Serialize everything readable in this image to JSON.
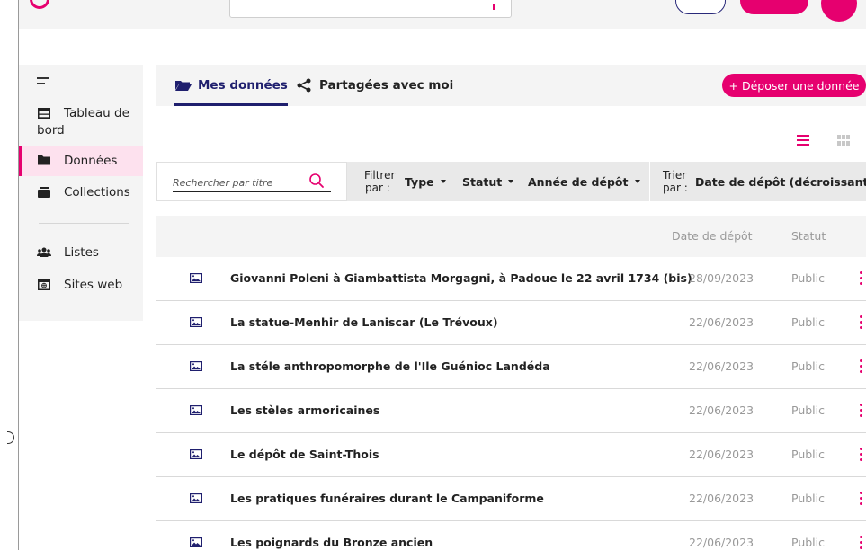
{
  "sidebar": {
    "items": [
      {
        "key": "dashboard",
        "label": "Tableau de bord",
        "icon": "table-icon"
      },
      {
        "key": "data",
        "label": "Données",
        "icon": "folder-icon",
        "active": true
      },
      {
        "key": "collections",
        "label": "Collections",
        "icon": "collections-icon"
      },
      {
        "key": "lists",
        "label": "Listes",
        "icon": "users-icon"
      },
      {
        "key": "websites",
        "label": "Sites web",
        "icon": "website-icon"
      }
    ]
  },
  "tabs": [
    {
      "label": "Mes données",
      "icon": "folder-open-icon",
      "active": true
    },
    {
      "label": "Partagées avec moi",
      "icon": "share-icon"
    }
  ],
  "deposit_button": "+ Déposer une donnée",
  "search": {
    "placeholder": "Rechercher par titre"
  },
  "filters": {
    "label": "Filtrer par :",
    "label_line1": "Filtrer",
    "label_line2": "par :",
    "type": "Type",
    "status": "Statut",
    "year": "Année de dépôt"
  },
  "sort": {
    "label_line1": "Trier",
    "label_line2": "par :",
    "value": "Date de dépôt (décroissante)"
  },
  "table": {
    "columns": {
      "date": "Date de dépôt",
      "status": "Statut"
    },
    "rows": [
      {
        "title": "Giovanni Poleni à Giambattista Morgagni, à Padoue le 22 avril 1734 (bis)",
        "date": "28/09/2023",
        "status": "Public"
      },
      {
        "title": "La statue-Menhir de Laniscar (Le Trévoux)",
        "date": "22/06/2023",
        "status": "Public"
      },
      {
        "title": "La stéle anthropomorphe de l'Ile Guénioc Landéda",
        "date": "22/06/2023",
        "status": "Public"
      },
      {
        "title": "Les stèles armoricaines",
        "date": "22/06/2023",
        "status": "Public"
      },
      {
        "title": "Le dépôt de Saint-Thois",
        "date": "22/06/2023",
        "status": "Public"
      },
      {
        "title": "Les pratiques funéraires durant le Campaniforme",
        "date": "22/06/2023",
        "status": "Public"
      },
      {
        "title": "Les poignards du Bronze ancien",
        "date": "22/06/2023",
        "status": "Public"
      }
    ]
  },
  "colors": {
    "accent": "#e6006f",
    "navy": "#1f1f6e",
    "muted": "#999999"
  }
}
